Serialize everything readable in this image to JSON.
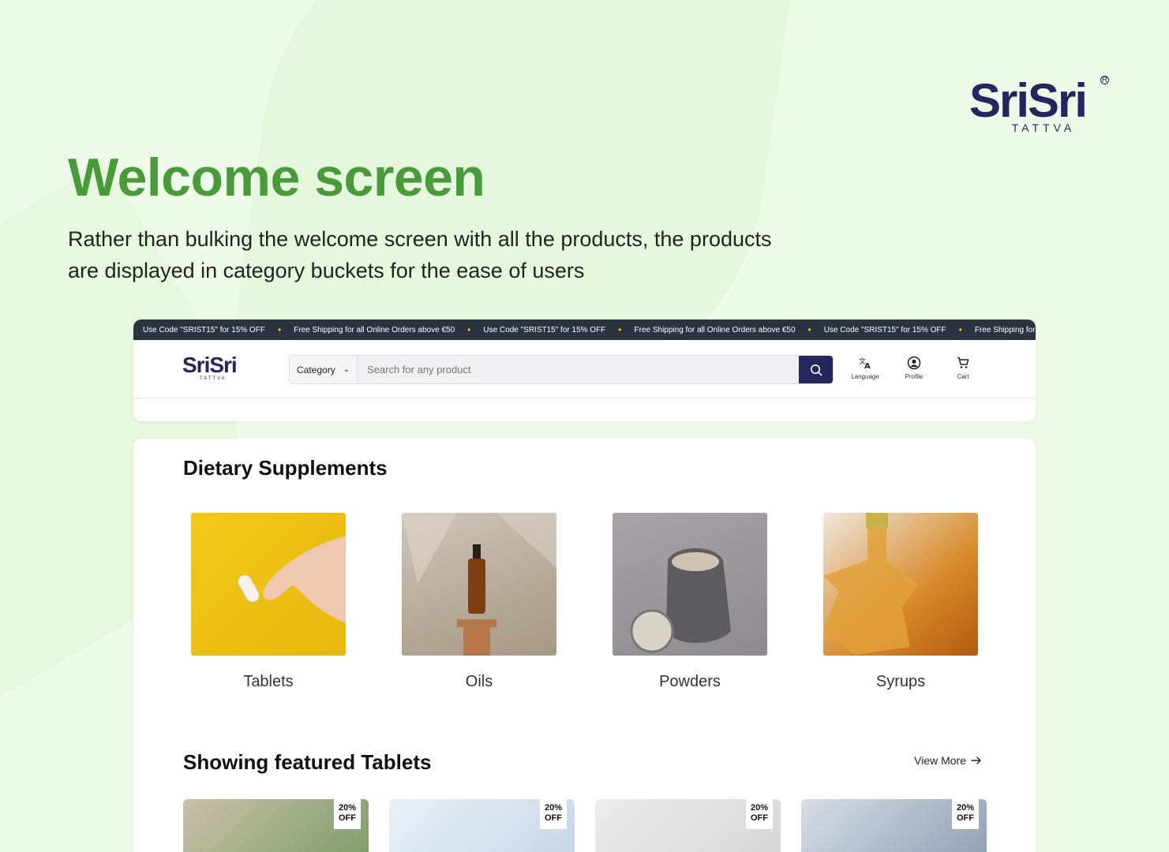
{
  "brand": {
    "name": "SriSri",
    "sub": "TATTVA",
    "reg": "R"
  },
  "hero": {
    "title": "Welcome screen",
    "description": "Rather than bulking the welcome screen with all the products, the products are displayed in category buckets for the ease of users"
  },
  "ticker": [
    "Use Code \"SRIST15\" for 15% OFF",
    "Free Shipping for all Online Orders above €50",
    "Use Code \"SRIST15\" for 15% OFF",
    "Free Shipping for all Online Orders above €50",
    "Use Code \"SRIST15\" for 15% OFF",
    "Free Shipping for all Onlin"
  ],
  "navbar": {
    "logo": "SriSri",
    "logo_sub": "TATTVA",
    "category_label": "Category",
    "search_placeholder": "Search for any product",
    "icons": [
      {
        "label": "Language",
        "icon": "translate-icon"
      },
      {
        "label": "Profile",
        "icon": "profile-icon"
      },
      {
        "label": "Cart",
        "icon": "cart-icon"
      }
    ]
  },
  "supplements": {
    "title": "Dietary Supplements",
    "categories": [
      {
        "label": "Tablets"
      },
      {
        "label": "Oils"
      },
      {
        "label": "Powders"
      },
      {
        "label": "Syrups"
      }
    ]
  },
  "featured": {
    "title": "Showing featured Tablets",
    "view_more": "View More",
    "products": [
      {
        "badge_line1": "20%",
        "badge_line2": "OFF"
      },
      {
        "badge_line1": "20%",
        "badge_line2": "OFF"
      },
      {
        "badge_line1": "20%",
        "badge_line2": "OFF"
      },
      {
        "badge_line1": "20%",
        "badge_line2": "OFF"
      }
    ]
  },
  "colors": {
    "accent_green": "#4a9a3c",
    "brand_navy": "#24265c",
    "ticker_bg": "#2c3340"
  }
}
